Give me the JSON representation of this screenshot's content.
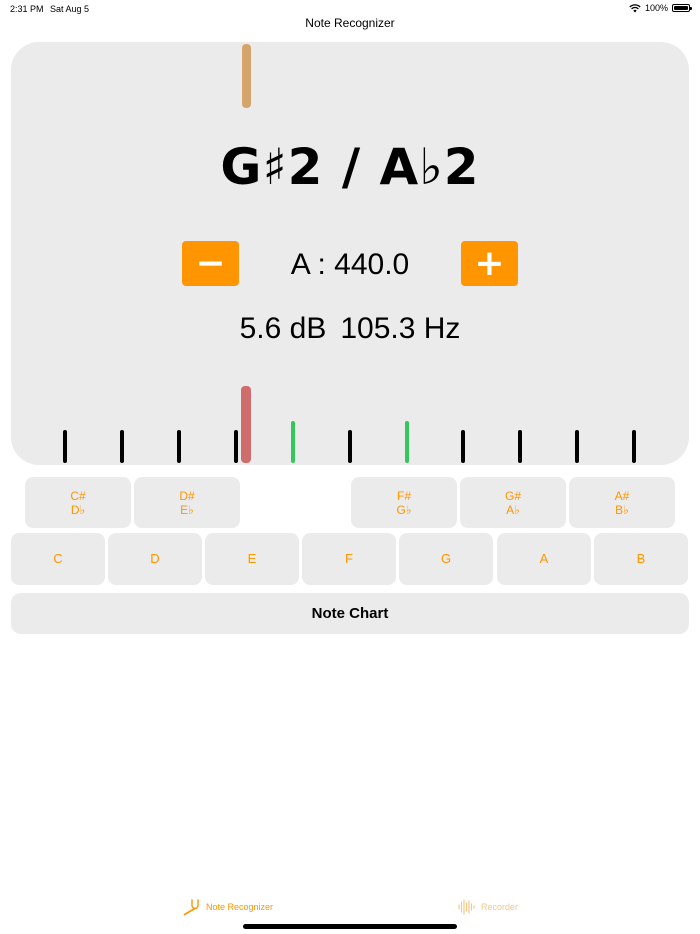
{
  "status_bar": {
    "time": "2:31 PM",
    "date": "Sat Aug 5",
    "battery": "100%"
  },
  "nav": {
    "title": "Note Recognizer"
  },
  "tuner": {
    "note": "G♯2 / A♭2",
    "minus_label": "−",
    "plus_label": "+",
    "reference": "A : 440.0",
    "level": "5.6 dB",
    "frequency": "105.3 Hz"
  },
  "sharp_keys": [
    {
      "sharp": "C#",
      "flat": "D♭"
    },
    {
      "sharp": "D#",
      "flat": "E♭"
    },
    {
      "sharp": "F#",
      "flat": "G♭"
    },
    {
      "sharp": "G#",
      "flat": "A♭"
    },
    {
      "sharp": "A#",
      "flat": "B♭"
    }
  ],
  "natural_keys": [
    "C",
    "D",
    "E",
    "F",
    "G",
    "A",
    "B"
  ],
  "note_chart": {
    "label": "Note Chart"
  },
  "tabs": [
    {
      "label": "Note Recognizer",
      "icon": "tuning-fork-icon",
      "active": true
    },
    {
      "label": "Recorder",
      "icon": "waveform-icon",
      "active": false
    }
  ],
  "colors": {
    "accent": "#ff9500",
    "panel": "#ebebeb",
    "in_tune": "#34c759",
    "needle": "#cf6d6d",
    "target": "#d5a46c"
  }
}
